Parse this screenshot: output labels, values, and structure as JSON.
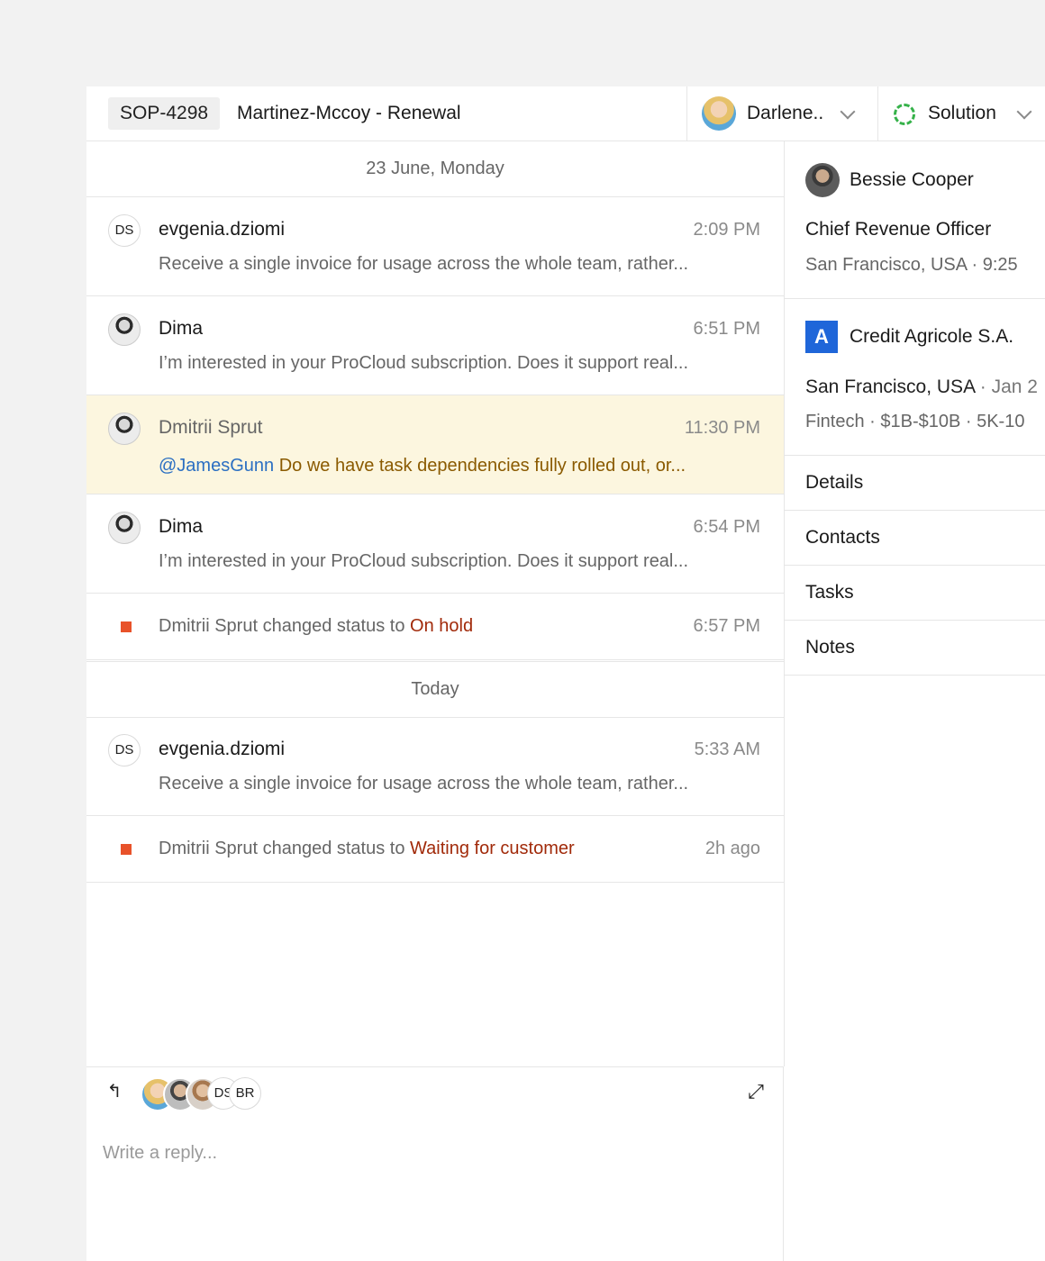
{
  "header": {
    "ticket_id": "SOP-4298",
    "title": "Martinez-Mccoy - Renewal",
    "assignee": "Darlene..",
    "status": "Solution"
  },
  "timeline": {
    "date_1": "23 June, Monday",
    "messages_1": [
      {
        "avatar_initials": "DS",
        "name": "evgenia.dziomi",
        "time": "2:09 PM",
        "text": "Receive a single invoice for usage across the whole team, rather..."
      },
      {
        "name": "Dima",
        "time": "6:51 PM",
        "text": "I’m interested in your ProCloud subscription. Does it support real..."
      },
      {
        "name": "Dmitrii Sprut",
        "time": "11:30 PM",
        "mention": "@JamesGunn",
        "text": " Do we have task dependencies fully rolled out, or..."
      },
      {
        "name": "Dima",
        "time": "6:54 PM",
        "text": "I’m interested in your ProCloud subscription. Does it support real..."
      }
    ],
    "status_change_1": {
      "actor": "Dmitrii Sprut",
      "verb": " changed status to ",
      "value": "On hold",
      "time": "6:57 PM"
    },
    "date_2": "Today",
    "message_today": {
      "avatar_initials": "DS",
      "name": "evgenia.dziomi",
      "time": "5:33 AM",
      "text": "Receive a single invoice for usage across the whole team, rather..."
    },
    "status_change_2": {
      "actor": "Dmitrii Sprut",
      "verb": " changed status to ",
      "value": "Waiting for customer",
      "time": "2h ago"
    }
  },
  "composer": {
    "participant_initials": [
      "DS",
      "BR"
    ],
    "placeholder": "Write a reply..."
  },
  "sidebar": {
    "contact": {
      "name": "Bessie Cooper",
      "role": "Chief Revenue Officer",
      "location": "San Francisco, USA · 9:25"
    },
    "company": {
      "logo_letter": "A",
      "name": "Credit Agricole S.A.",
      "location": "San Francisco, USA",
      "location_extra": " · Jan 2",
      "meta": "Fintech · $1B-$10B · 5K-10"
    },
    "tabs": [
      "Details",
      "Contacts",
      "Tasks",
      "Notes"
    ]
  },
  "colors": {
    "accent_status": "#e8522a",
    "status_value": "#a12a0a",
    "mention": "#2b6fc2",
    "highlight_bg": "#fcf6df",
    "company_logo": "#1f66d9",
    "status_ring": "#36b24a"
  }
}
